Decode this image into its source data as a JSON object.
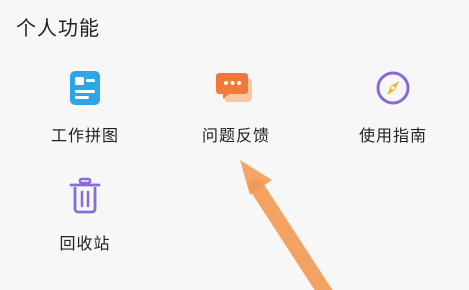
{
  "section": {
    "title": "个人功能"
  },
  "features": [
    {
      "label": "工作拼图",
      "icon": "puzzle-card-icon"
    },
    {
      "label": "问题反馈",
      "icon": "chat-bubble-icon"
    },
    {
      "label": "使用指南",
      "icon": "compass-icon"
    },
    {
      "label": "回收站",
      "icon": "trash-icon"
    }
  ],
  "colors": {
    "puzzle": "#2ea5e5",
    "feedback": "#f07a3a",
    "compass": "#8a6ad6",
    "trash": "#8a6ad6",
    "arrow": "#f29a55"
  }
}
